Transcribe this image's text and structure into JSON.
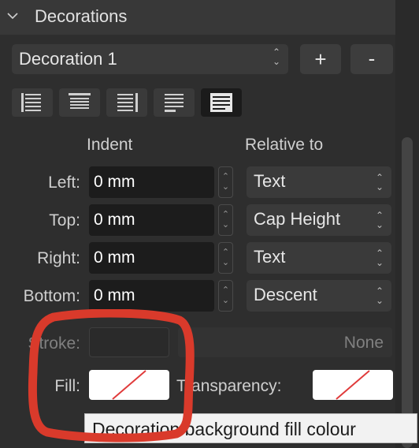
{
  "panel": {
    "title": "Decorations",
    "decoration_select": "Decoration 1",
    "add_label": "+",
    "remove_label": "-"
  },
  "columns": {
    "indent": "Indent",
    "relative_to": "Relative to"
  },
  "rows": [
    {
      "label": "Left:",
      "value": "0 mm",
      "relative": "Text"
    },
    {
      "label": "Top:",
      "value": "0 mm",
      "relative": "Cap Height"
    },
    {
      "label": "Right:",
      "value": "0 mm",
      "relative": "Text"
    },
    {
      "label": "Bottom:",
      "value": "0 mm",
      "relative": "Descent"
    }
  ],
  "stroke": {
    "label": "Stroke:",
    "value": "None"
  },
  "fill": {
    "label": "Fill:",
    "transparency_label": "Transparency:"
  },
  "tooltip": "Decoration background fill colour",
  "icons": {
    "collapse": "chevron-down-icon",
    "align": [
      "align-left-icon",
      "align-center-icon",
      "align-right-icon",
      "align-top-icon",
      "align-full-icon"
    ]
  },
  "colors": {
    "annotation": "#d93a2b",
    "swatch_slash": "#e03b3b"
  }
}
